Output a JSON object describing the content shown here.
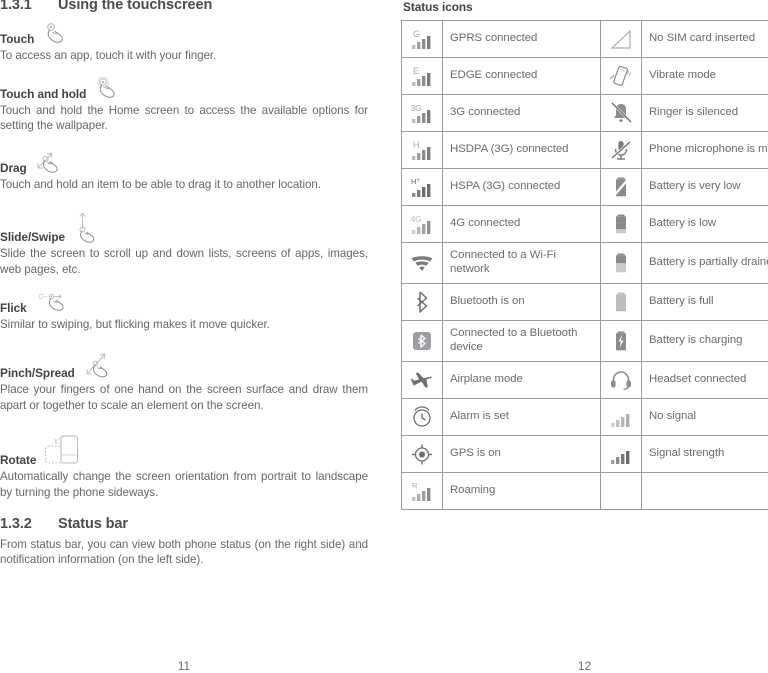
{
  "left_page": {
    "section": {
      "number": "1.3.1",
      "title": "Using the touchscreen"
    },
    "gestures": [
      {
        "label": "Touch",
        "icon": "hand-touch-icon",
        "text": "To access an app, touch it with your finger."
      },
      {
        "label": "Touch and hold",
        "icon": "hand-touch-hold-icon",
        "text": "Touch and hold the Home screen to access the available options for setting the wallpaper."
      },
      {
        "label": "Drag",
        "icon": "hand-drag-icon",
        "text": "Touch and hold an item to be able to drag it to another location."
      },
      {
        "label": "Slide/Swipe",
        "icon": "hand-slide-swipe-icon",
        "text": "Slide the screen to scroll up and down lists, screens of apps, images, web pages, etc."
      },
      {
        "label": "Flick",
        "icon": "hand-flick-icon",
        "text": "Similar to swiping, but flicking makes it move quicker."
      },
      {
        "label": "Pinch/Spread",
        "icon": "hand-pinch-spread-icon",
        "text": "Place your fingers of one hand on the screen surface and draw them apart or together to scale an element on the screen."
      },
      {
        "label": "Rotate",
        "icon": "phone-rotate-icon",
        "text": "Automatically change the screen orientation from portrait to landscape by turning the phone sideways."
      }
    ],
    "section2": {
      "number": "1.3.2",
      "title": "Status bar"
    },
    "section2_text": "From status bar, you can view both phone status (on the right side) and notification information (on the left side).",
    "page_number": "11"
  },
  "right_page": {
    "title": "Status icons",
    "page_number": "12",
    "rows": [
      {
        "left": {
          "icon": "signal-bars-gprs-icon",
          "icon_label": "G",
          "label": "GPRS connected"
        },
        "right": {
          "icon": "no-sim-card-icon",
          "icon_label": "",
          "label": "No SIM card inserted"
        }
      },
      {
        "left": {
          "icon": "signal-bars-edge-icon",
          "icon_label": "E",
          "label": "EDGE connected"
        },
        "right": {
          "icon": "vibrate-mode-icon",
          "icon_label": "",
          "label": "Vibrate mode"
        }
      },
      {
        "left": {
          "icon": "signal-bars-3g-icon",
          "icon_label": "3G",
          "label": "3G connected"
        },
        "right": {
          "icon": "ringer-silenced-icon",
          "icon_label": "",
          "label": "Ringer is silenced"
        }
      },
      {
        "left": {
          "icon": "signal-bars-hsdpa-icon",
          "icon_label": "H",
          "label": "HSDPA (3G) connected"
        },
        "right": {
          "icon": "microphone-mute-icon",
          "icon_label": "",
          "label": "Phone microphone is mute"
        }
      },
      {
        "left": {
          "icon": "signal-bars-hspa-icon",
          "icon_label": "H+",
          "label": "HSPA (3G) connected"
        },
        "right": {
          "icon": "battery-very-low-icon",
          "icon_label": "",
          "label": "Battery is very low"
        }
      },
      {
        "left": {
          "icon": "signal-bars-4g-icon",
          "icon_label": "4G",
          "label": "4G connected"
        },
        "right": {
          "icon": "battery-low-icon",
          "icon_label": "",
          "label": "Battery is low"
        }
      },
      {
        "left": {
          "icon": "wifi-icon",
          "icon_label": "",
          "label": "Connected to a Wi-Fi network"
        },
        "right": {
          "icon": "battery-partial-icon",
          "icon_label": "",
          "label": "Battery is partially drained"
        }
      },
      {
        "left": {
          "icon": "bluetooth-on-icon",
          "icon_label": "",
          "label": "Bluetooth is on"
        },
        "right": {
          "icon": "battery-full-icon",
          "icon_label": "",
          "label": "Battery is full"
        }
      },
      {
        "left": {
          "icon": "bluetooth-connected-icon",
          "icon_label": "",
          "label": "Connected to a Bluetooth device"
        },
        "right": {
          "icon": "battery-charging-icon",
          "icon_label": "",
          "label": "Battery is charging"
        }
      },
      {
        "left": {
          "icon": "airplane-mode-icon",
          "icon_label": "",
          "label": "Airplane mode"
        },
        "right": {
          "icon": "headset-icon",
          "icon_label": "",
          "label": "Headset connected"
        }
      },
      {
        "left": {
          "icon": "alarm-clock-icon",
          "icon_label": "",
          "label": "Alarm is set"
        },
        "right": {
          "icon": "signal-bars-empty-icon",
          "icon_label": "",
          "label": "No signal"
        }
      },
      {
        "left": {
          "icon": "gps-icon",
          "icon_label": "",
          "label": "GPS is on"
        },
        "right": {
          "icon": "signal-bars-full-icon",
          "icon_label": "",
          "label": "Signal strength"
        }
      },
      {
        "left": {
          "icon": "signal-bars-roaming-icon",
          "icon_label": "R",
          "label": "Roaming"
        },
        "right": {
          "icon": "",
          "icon_label": "",
          "label": ""
        }
      }
    ]
  },
  "colors": {
    "text": "#666769",
    "heading": "#414244",
    "border": "#9a9b9e",
    "icon_dark": "#6d6e70",
    "icon_light": "#bcbdc0"
  }
}
